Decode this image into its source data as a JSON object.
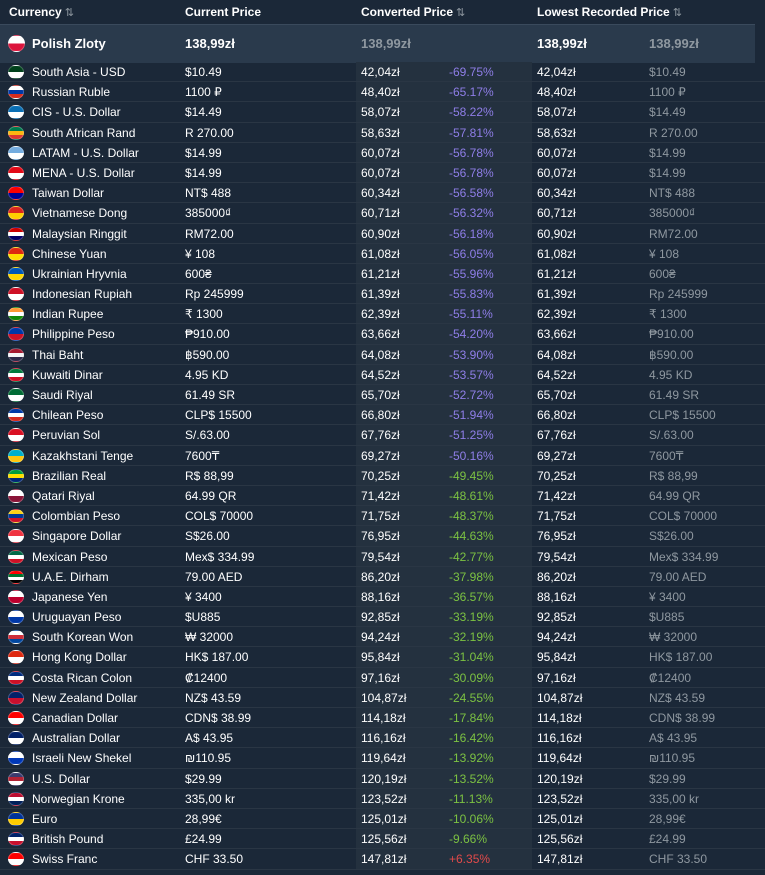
{
  "header": {
    "currency": "Currency",
    "current_price": "Current Price",
    "converted_price": "Converted Price",
    "lowest_recorded": "Lowest Recorded Price",
    "sort_glyph": "⇅"
  },
  "base": {
    "name": "Polish Zloty",
    "current": "138,99zł",
    "converted": "138,99zł",
    "lowest": "138,99zł",
    "lowest_orig": "138,99zł",
    "flag": [
      "#ffffff",
      "#dc143c"
    ]
  },
  "rows": [
    {
      "name": "South Asia - USD",
      "current": "$10.49",
      "converted": "42,04zł",
      "pct": "-69.75%",
      "lowest": "42,04zł",
      "lowest_orig": "$10.49",
      "flag": [
        "#01411c",
        "#ffffff"
      ]
    },
    {
      "name": "Russian Ruble",
      "current": "1100 ₽",
      "converted": "48,40zł",
      "pct": "-65.17%",
      "lowest": "48,40zł",
      "lowest_orig": "1100 ₽",
      "flag": [
        "#ffffff",
        "#0039a6",
        "#d52b1e"
      ]
    },
    {
      "name": "CIS - U.S. Dollar",
      "current": "$14.49",
      "converted": "58,07zł",
      "pct": "-58.22%",
      "lowest": "58,07zł",
      "lowest_orig": "$14.49",
      "flag": [
        "#0a6fb5",
        "#ffffff"
      ]
    },
    {
      "name": "South African Rand",
      "current": "R 270.00",
      "converted": "58,63zł",
      "pct": "-57.81%",
      "lowest": "58,63zł",
      "lowest_orig": "R 270.00",
      "flag": [
        "#007a4d",
        "#ffb612",
        "#de3831"
      ]
    },
    {
      "name": "LATAM - U.S. Dollar",
      "current": "$14.99",
      "converted": "60,07zł",
      "pct": "-56.78%",
      "lowest": "60,07zł",
      "lowest_orig": "$14.99",
      "flag": [
        "#74acdf",
        "#ffffff"
      ]
    },
    {
      "name": "MENA - U.S. Dollar",
      "current": "$14.99",
      "converted": "60,07zł",
      "pct": "-56.78%",
      "lowest": "60,07zł",
      "lowest_orig": "$14.99",
      "flag": [
        "#e30a17",
        "#ffffff"
      ]
    },
    {
      "name": "Taiwan Dollar",
      "current": "NT$ 488",
      "converted": "60,34zł",
      "pct": "-56.58%",
      "lowest": "60,34zł",
      "lowest_orig": "NT$ 488",
      "flag": [
        "#fe0000",
        "#000095"
      ]
    },
    {
      "name": "Vietnamese Dong",
      "current": "385000₫",
      "converted": "60,71zł",
      "pct": "-56.32%",
      "lowest": "60,71zł",
      "lowest_orig": "385000₫",
      "flag": [
        "#da251d",
        "#ffcd00"
      ]
    },
    {
      "name": "Malaysian Ringgit",
      "current": "RM72.00",
      "converted": "60,90zł",
      "pct": "-56.18%",
      "lowest": "60,90zł",
      "lowest_orig": "RM72.00",
      "flag": [
        "#cc0001",
        "#ffffff",
        "#010066"
      ]
    },
    {
      "name": "Chinese Yuan",
      "current": "¥ 108",
      "converted": "61,08zł",
      "pct": "-56.05%",
      "lowest": "61,08zł",
      "lowest_orig": "¥ 108",
      "flag": [
        "#de2910",
        "#ffde00"
      ]
    },
    {
      "name": "Ukrainian Hryvnia",
      "current": "600₴",
      "converted": "61,21zł",
      "pct": "-55.96%",
      "lowest": "61,21zł",
      "lowest_orig": "600₴",
      "flag": [
        "#0057b7",
        "#ffd700"
      ]
    },
    {
      "name": "Indonesian Rupiah",
      "current": "Rp 245999",
      "converted": "61,39zł",
      "pct": "-55.83%",
      "lowest": "61,39zł",
      "lowest_orig": "Rp 245999",
      "flag": [
        "#ce1126",
        "#ffffff"
      ]
    },
    {
      "name": "Indian Rupee",
      "current": "₹ 1300",
      "converted": "62,39zł",
      "pct": "-55.11%",
      "lowest": "62,39zł",
      "lowest_orig": "₹ 1300",
      "flag": [
        "#ff9933",
        "#ffffff",
        "#138808"
      ]
    },
    {
      "name": "Philippine Peso",
      "current": "₱910.00",
      "converted": "63,66zł",
      "pct": "-54.20%",
      "lowest": "63,66zł",
      "lowest_orig": "₱910.00",
      "flag": [
        "#0038a8",
        "#ce1126"
      ]
    },
    {
      "name": "Thai Baht",
      "current": "฿590.00",
      "converted": "64,08zł",
      "pct": "-53.90%",
      "lowest": "64,08zł",
      "lowest_orig": "฿590.00",
      "flag": [
        "#a51931",
        "#f4f5f8",
        "#2d2a4a"
      ]
    },
    {
      "name": "Kuwaiti Dinar",
      "current": "4.95 KD",
      "converted": "64,52zł",
      "pct": "-53.57%",
      "lowest": "64,52zł",
      "lowest_orig": "4.95 KD",
      "flag": [
        "#007a3d",
        "#ffffff",
        "#ce1126"
      ]
    },
    {
      "name": "Saudi Riyal",
      "current": "61.49 SR",
      "converted": "65,70zł",
      "pct": "-52.72%",
      "lowest": "65,70zł",
      "lowest_orig": "61.49 SR",
      "flag": [
        "#006c35",
        "#ffffff"
      ]
    },
    {
      "name": "Chilean Peso",
      "current": "CLP$ 15500",
      "converted": "66,80zł",
      "pct": "-51.94%",
      "lowest": "66,80zł",
      "lowest_orig": "CLP$ 15500",
      "flag": [
        "#0039a6",
        "#ffffff",
        "#d52b1e"
      ]
    },
    {
      "name": "Peruvian Sol",
      "current": "S/.63.00",
      "converted": "67,76zł",
      "pct": "-51.25%",
      "lowest": "67,76zł",
      "lowest_orig": "S/.63.00",
      "flag": [
        "#d91023",
        "#ffffff"
      ]
    },
    {
      "name": "Kazakhstani Tenge",
      "current": "7600₸",
      "converted": "69,27zł",
      "pct": "-50.16%",
      "lowest": "69,27zł",
      "lowest_orig": "7600₸",
      "flag": [
        "#00afca",
        "#fec50c"
      ]
    },
    {
      "name": "Brazilian Real",
      "current": "R$ 88,99",
      "converted": "70,25zł",
      "pct": "-49.45%",
      "lowest": "70,25zł",
      "lowest_orig": "R$ 88,99",
      "flag": [
        "#009c3b",
        "#ffdf00",
        "#002776"
      ]
    },
    {
      "name": "Qatari Riyal",
      "current": "64.99 QR",
      "converted": "71,42zł",
      "pct": "-48.61%",
      "lowest": "71,42zł",
      "lowest_orig": "64.99 QR",
      "flag": [
        "#ffffff",
        "#8a1538"
      ]
    },
    {
      "name": "Colombian Peso",
      "current": "COL$ 70000",
      "converted": "71,75zł",
      "pct": "-48.37%",
      "lowest": "71,75zł",
      "lowest_orig": "COL$ 70000",
      "flag": [
        "#fcd116",
        "#003893",
        "#ce1126"
      ]
    },
    {
      "name": "Singapore Dollar",
      "current": "S$26.00",
      "converted": "76,95zł",
      "pct": "-44.63%",
      "lowest": "76,95zł",
      "lowest_orig": "S$26.00",
      "flag": [
        "#ef3340",
        "#ffffff"
      ]
    },
    {
      "name": "Mexican Peso",
      "current": "Mex$ 334.99",
      "converted": "79,54zł",
      "pct": "-42.77%",
      "lowest": "79,54zł",
      "lowest_orig": "Mex$ 334.99",
      "flag": [
        "#006847",
        "#ffffff",
        "#ce1126"
      ]
    },
    {
      "name": "U.A.E. Dirham",
      "current": "79.00 AED",
      "converted": "86,20zł",
      "pct": "-37.98%",
      "lowest": "86,20zł",
      "lowest_orig": "79.00 AED",
      "flag": [
        "#ff0000",
        "#00732f",
        "#ffffff",
        "#000000"
      ]
    },
    {
      "name": "Japanese Yen",
      "current": "¥ 3400",
      "converted": "88,16zł",
      "pct": "-36.57%",
      "lowest": "88,16zł",
      "lowest_orig": "¥ 3400",
      "flag": [
        "#ffffff",
        "#bc002d"
      ]
    },
    {
      "name": "Uruguayan Peso",
      "current": "$U885",
      "converted": "92,85zł",
      "pct": "-33.19%",
      "lowest": "92,85zł",
      "lowest_orig": "$U885",
      "flag": [
        "#ffffff",
        "#0038a8"
      ]
    },
    {
      "name": "South Korean Won",
      "current": "₩ 32000",
      "converted": "94,24zł",
      "pct": "-32.19%",
      "lowest": "94,24zł",
      "lowest_orig": "₩ 32000",
      "flag": [
        "#ffffff",
        "#cd2e3a",
        "#0047a0"
      ]
    },
    {
      "name": "Hong Kong Dollar",
      "current": "HK$ 187.00",
      "converted": "95,84zł",
      "pct": "-31.04%",
      "lowest": "95,84zł",
      "lowest_orig": "HK$ 187.00",
      "flag": [
        "#de2910",
        "#ffffff"
      ]
    },
    {
      "name": "Costa Rican Colon",
      "current": "₡12400",
      "converted": "97,16zł",
      "pct": "-30.09%",
      "lowest": "97,16zł",
      "lowest_orig": "₡12400",
      "flag": [
        "#002b7f",
        "#ffffff",
        "#ce1126"
      ]
    },
    {
      "name": "New Zealand Dollar",
      "current": "NZ$ 43.59",
      "converted": "104,87zł",
      "pct": "-24.55%",
      "lowest": "104,87zł",
      "lowest_orig": "NZ$ 43.59",
      "flag": [
        "#012169",
        "#c8102e"
      ]
    },
    {
      "name": "Canadian Dollar",
      "current": "CDN$ 38.99",
      "converted": "114,18zł",
      "pct": "-17.84%",
      "lowest": "114,18zł",
      "lowest_orig": "CDN$ 38.99",
      "flag": [
        "#ff0000",
        "#ffffff"
      ]
    },
    {
      "name": "Australian Dollar",
      "current": "A$ 43.95",
      "converted": "116,16zł",
      "pct": "-16.42%",
      "lowest": "116,16zł",
      "lowest_orig": "A$ 43.95",
      "flag": [
        "#012169",
        "#ffffff"
      ]
    },
    {
      "name": "Israeli New Shekel",
      "current": "₪110.95",
      "converted": "119,64zł",
      "pct": "-13.92%",
      "lowest": "119,64zł",
      "lowest_orig": "₪110.95",
      "flag": [
        "#ffffff",
        "#0038b8"
      ]
    },
    {
      "name": "U.S. Dollar",
      "current": "$29.99",
      "converted": "120,19zł",
      "pct": "-13.52%",
      "lowest": "120,19zł",
      "lowest_orig": "$29.99",
      "flag": [
        "#3c3b6e",
        "#b22234",
        "#ffffff"
      ]
    },
    {
      "name": "Norwegian Krone",
      "current": "335,00 kr",
      "converted": "123,52zł",
      "pct": "-11.13%",
      "lowest": "123,52zł",
      "lowest_orig": "335,00 kr",
      "flag": [
        "#ba0c2f",
        "#ffffff",
        "#00205b"
      ]
    },
    {
      "name": "Euro",
      "current": "28,99€",
      "converted": "125,01zł",
      "pct": "-10.06%",
      "lowest": "125,01zł",
      "lowest_orig": "28,99€",
      "flag": [
        "#003399",
        "#ffcc00"
      ]
    },
    {
      "name": "British Pound",
      "current": "£24.99",
      "converted": "125,56zł",
      "pct": "-9.66%",
      "lowest": "125,56zł",
      "lowest_orig": "£24.99",
      "flag": [
        "#012169",
        "#ffffff",
        "#c8102e"
      ]
    },
    {
      "name": "Swiss Franc",
      "current": "CHF 33.50",
      "converted": "147,81zł",
      "pct": "+6.35%",
      "lowest": "147,81zł",
      "lowest_orig": "CHF 33.50",
      "flag": [
        "#ff0000",
        "#ffffff"
      ]
    }
  ]
}
